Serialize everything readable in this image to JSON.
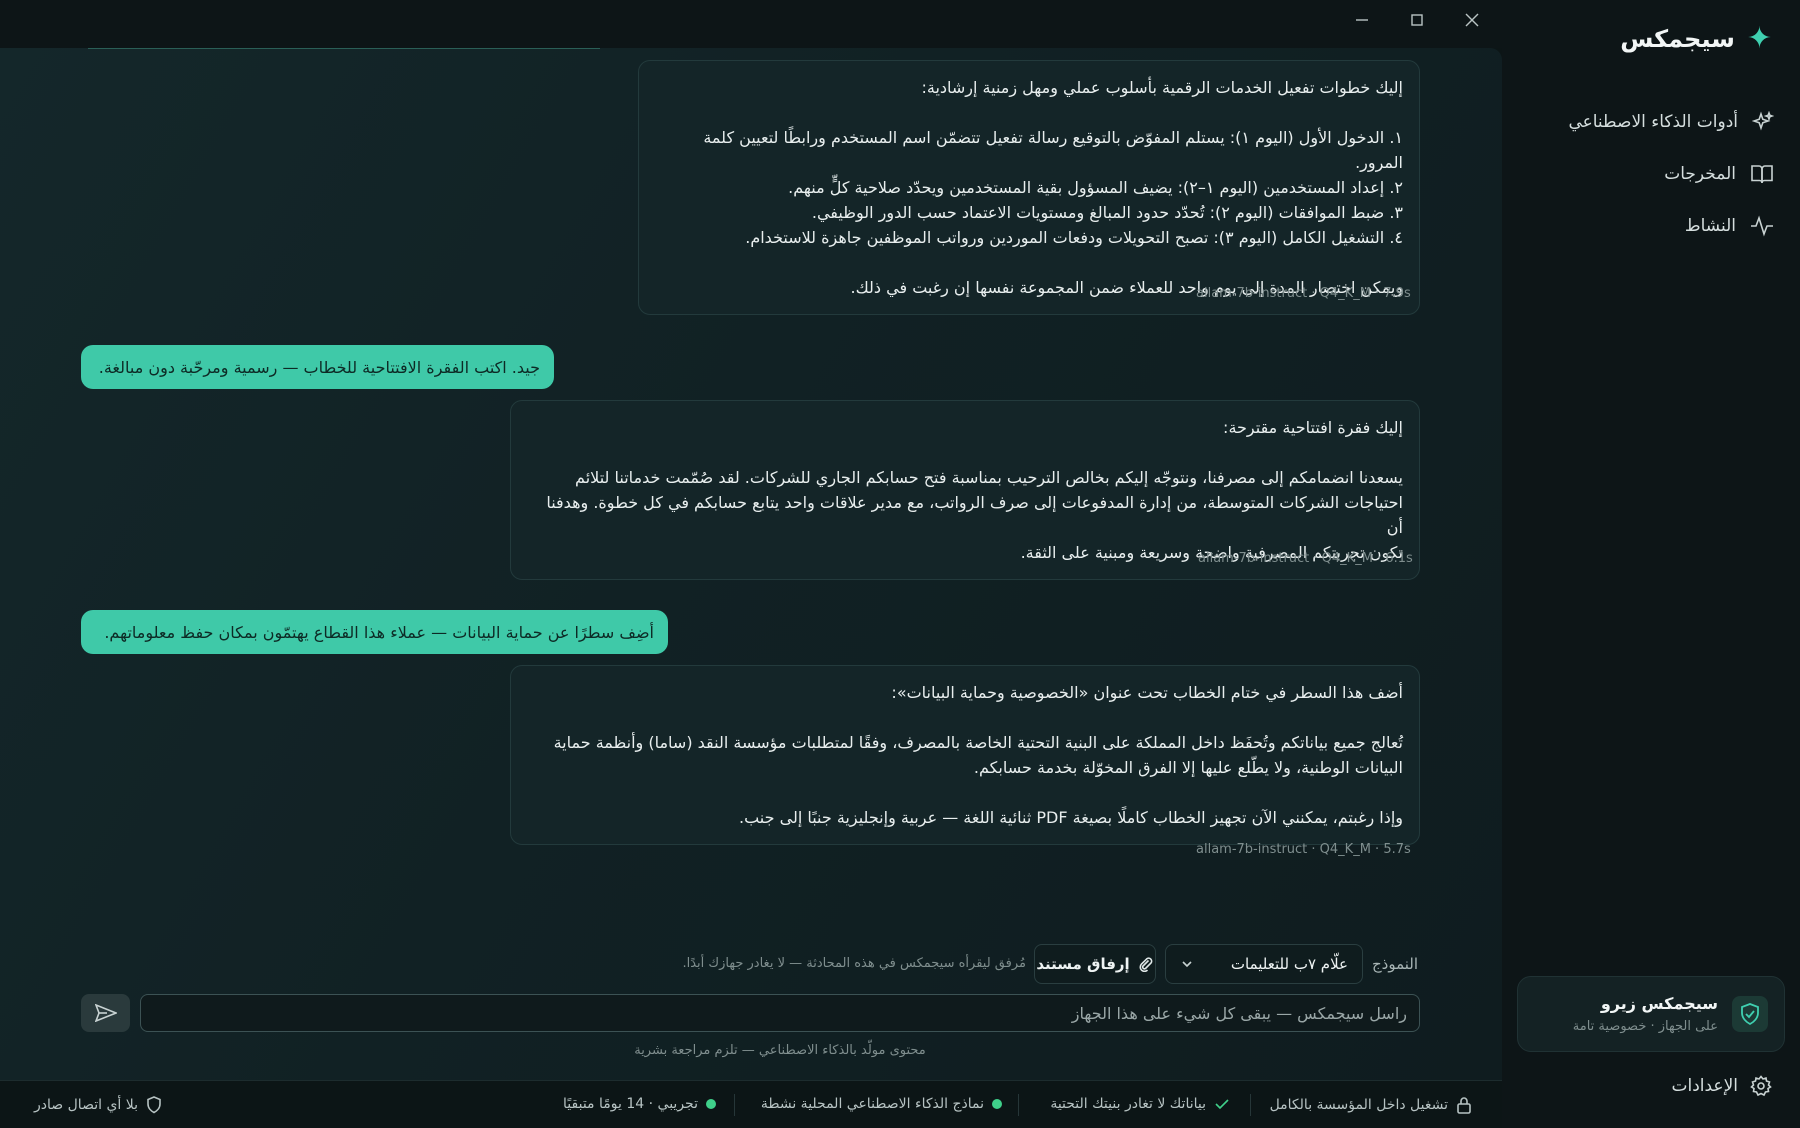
{
  "app": {
    "name": "سيجمكس"
  },
  "sidebar": {
    "items": [
      {
        "label": "أدوات الذكاء الاصطناعي",
        "icon": "sparkles-icon"
      },
      {
        "label": "المخرجات",
        "icon": "book-icon"
      },
      {
        "label": "النشاط",
        "icon": "activity-icon"
      }
    ],
    "zero_card": {
      "title": "سيجمكس زيرو",
      "subtitle": "على الجهاز · خصوصية تامة",
      "icon": "shield-check-icon"
    },
    "settings_label": "الإعدادات"
  },
  "conversation": {
    "m1": {
      "intro": "إليك خطوات تفعيل الخدمات الرقمية بأسلوب عملي ومهل زمنية إرشادية:",
      "step1": "١. الدخول الأول (اليوم ١): يستلم المفوّض بالتوقيع رسالة تفعيل تتضمّن اسم المستخدم ورابطًا لتعيين كلمة المرور.",
      "step2": "٢. إعداد المستخدمين (اليوم ١–٢): يضيف المسؤول بقية المستخدمين ويحدّد صلاحية كلٍّ منهم.",
      "step3": "٣. ضبط الموافقات (اليوم ٢): تُحدّد حدود المبالغ ومستويات الاعتماد حسب الدور الوظيفي.",
      "step4": "٤. التشغيل الكامل (اليوم ٣): تصبح التحويلات ودفعات الموردين ورواتب الموظفين جاهزة للاستخدام.",
      "outro": "ويمكن اختصار المدة إلى يوم واحد للعملاء ضمن المجموعة نفسها إن رغبت في ذلك.",
      "meta": "allam-7b-instruct · Q4_K_M · 7.9s"
    },
    "u1": "جيد. اكتب الفقرة الافتتاحية للخطاب — رسمية ومرحّبة دون مبالغة.",
    "m2": {
      "intro": "إليك فقرة افتتاحية مقترحة:",
      "line1": "يسعدنا انضمامكم إلى مصرفنا، ونتوجّه إليكم بخالص الترحيب بمناسبة فتح حسابكم الجاري للشركات. لقد صُمّمت خدماتنا لتلائم",
      "line2": "احتياجات الشركات المتوسطة، من إدارة المدفوعات إلى صرف الرواتب، مع مدير علاقات واحد يتابع حسابكم في كل خطوة. وهدفنا أن",
      "line3": "تكون تجربتكم المصرفية واضحة وسريعة ومبنية على الثقة.",
      "meta": "allam-7b-instruct · Q4_K_M · 6.1s"
    },
    "u2": "أضِف سطرًا عن حماية البيانات — عملاء هذا القطاع يهتمّون بمكان حفظ معلوماتهم.",
    "m3": {
      "intro": "أضف هذا السطر في ختام الخطاب تحت عنوان «الخصوصية وحماية البيانات»:",
      "line1": "تُعالج جميع بياناتكم وتُحفَظ داخل المملكة على البنية التحتية الخاصة بالمصرف، وفقًا لمتطلبات مؤسسة النقد (ساما) وأنظمة حماية",
      "line2": "البيانات الوطنية، ولا يطّلع عليها إلا الفرق المخوّلة بخدمة حسابكم.",
      "outro": "وإذا رغبتم، يمكنني الآن تجهيز الخطاب كاملًا بصيغة PDF ثنائية اللغة — عربية وإنجليزية جنبًا إلى جنب.",
      "meta": "allam-7b-instruct · Q4_K_M · 5.7s"
    }
  },
  "composer": {
    "model_label": "النموذج",
    "model_value": "علّام ٧ب للتعليمات",
    "attach_label": "إرفاق مستند",
    "attach_note": "مُرفق ليقرأه سيجمكس في هذه المحادثة — لا يغادر جهازك أبدًا.",
    "placeholder": "راسل سيجمكس — يبقى كل شيء على هذا الجهاز",
    "disclaimer": "محتوى مولّد بالذكاء الاصطناعي — تلزم مراجعة بشرية"
  },
  "statusbar": {
    "on_prem": "تشغيل داخل المؤسسة بالكامل",
    "data_stays": "بياناتك لا تغادر بنيتك التحتية",
    "models_active": "نماذج الذكاء الاصطناعي المحلية نشطة",
    "trial": "تجريبي · 14 يومًا متبقيًا",
    "no_outbound": "بلا أي اتصال صادر"
  },
  "colors": {
    "accent": "#3fc9a8",
    "status_dot": "#3fd08a"
  }
}
